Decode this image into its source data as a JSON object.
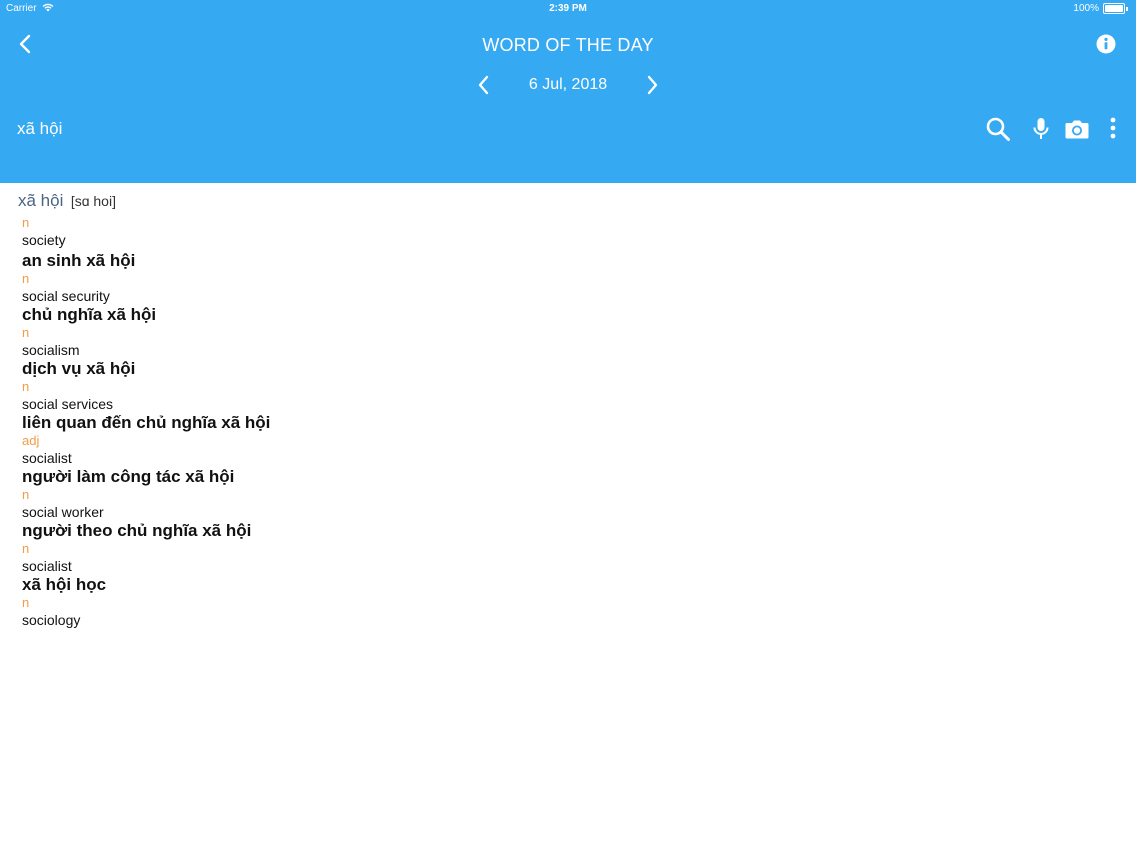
{
  "status_bar": {
    "carrier": "Carrier",
    "time": "2:39 PM",
    "battery": "100%"
  },
  "header": {
    "title": "WORD OF THE DAY",
    "date": "6 Jul, 2018",
    "query": "xã hội",
    "background_color": "#35a9f2",
    "icons": {
      "back": "chevron-left-icon",
      "info": "info-icon",
      "prev": "chevron-left-icon",
      "next": "chevron-right-icon",
      "search": "search-icon",
      "mic": "microphone-icon",
      "camera": "camera-icon",
      "more": "more-vertical-icon"
    }
  },
  "definition": {
    "headword": "xã hội",
    "pronunciation": "[sɑ hoi]",
    "main_pos": "n",
    "main_meaning": "society",
    "pos_color": "#f39c4a",
    "headword_color": "#4a6585",
    "phrases": [
      {
        "phrase": "an sinh xã hội",
        "pos": "n",
        "meaning": "social security"
      },
      {
        "phrase": "chủ nghĩa xã hội",
        "pos": "n",
        "meaning": "socialism"
      },
      {
        "phrase": "dịch vụ xã hội",
        "pos": "n",
        "meaning": "social services"
      },
      {
        "phrase": "liên quan đến chủ nghĩa xã hội",
        "pos": "adj",
        "meaning": "socialist"
      },
      {
        "phrase": "người làm công tác xã hội",
        "pos": "n",
        "meaning": "social worker"
      },
      {
        "phrase": "người theo chủ nghĩa xã hội",
        "pos": "n",
        "meaning": "socialist"
      },
      {
        "phrase": "xã hội học",
        "pos": "n",
        "meaning": "sociology"
      }
    ]
  }
}
